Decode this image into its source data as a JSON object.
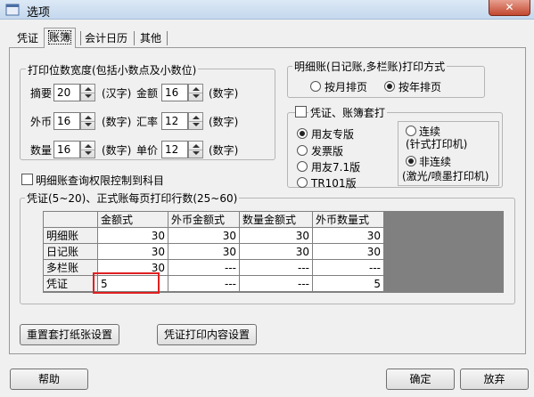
{
  "window": {
    "title": "选项",
    "close_label": "✕"
  },
  "tabs": [
    {
      "label": "凭证"
    },
    {
      "label": "账簿",
      "active": true
    },
    {
      "label": "会计日历"
    },
    {
      "label": "其他"
    }
  ],
  "print_width": {
    "title": "打印位数宽度(包括小数点及小数位)",
    "rows": [
      {
        "left_label": "摘要",
        "left_value": "20",
        "left_unit": "(汉字)",
        "right_label": "金额",
        "right_value": "16",
        "right_unit": "(数字)"
      },
      {
        "left_label": "外币",
        "left_value": "16",
        "left_unit": "(数字)",
        "right_label": "汇率",
        "right_value": "12",
        "right_unit": "(数字)"
      },
      {
        "left_label": "数量",
        "left_value": "16",
        "left_unit": "(数字)",
        "right_label": "单价",
        "right_value": "12",
        "right_unit": "(数字)"
      }
    ]
  },
  "detail_print_mode": {
    "title": "明细账(日记账,多栏账)打印方式",
    "options": [
      {
        "label": "按月排页",
        "selected": false
      },
      {
        "label": "按年排页",
        "selected": true
      }
    ]
  },
  "voucher_ledger_set_print": {
    "checkbox_label": "凭证、账簿套打",
    "checked": false,
    "versions": [
      {
        "label": "用友专版",
        "selected": true
      },
      {
        "label": "发票版",
        "selected": false
      },
      {
        "label": "用友7.1版",
        "selected": false
      },
      {
        "label": "TR101版",
        "selected": false
      }
    ],
    "continuous": {
      "label": "连续",
      "sublabel": "(针式打印机)",
      "selected": false
    },
    "non_continuous": {
      "label": "非连续",
      "sublabel": "(激光/喷墨打印机)",
      "selected": true
    }
  },
  "permission_check": {
    "label": "明细账查询权限控制到科目",
    "checked": false
  },
  "rows_per_page": {
    "title": "凭证(5~20)、正式账每页打印行数(25~60)",
    "columns": [
      "",
      "金额式",
      "外币金额式",
      "数量金额式",
      "外币数量式"
    ],
    "rows": [
      {
        "name": "明细账",
        "values": [
          "30",
          "30",
          "30",
          "30"
        ]
      },
      {
        "name": "日记账",
        "values": [
          "30",
          "30",
          "30",
          "30"
        ]
      },
      {
        "name": "多栏账",
        "values": [
          "30",
          "---",
          "---",
          "---"
        ]
      },
      {
        "name": "凭证",
        "values": [
          "5",
          "---",
          "---",
          "5"
        ]
      }
    ]
  },
  "buttons": {
    "reset_paper": "重置套打纸张设置",
    "voucher_print_content": "凭证打印内容设置",
    "help": "帮助",
    "ok": "确定",
    "cancel": "放弃"
  },
  "colors": {
    "highlight_border": "#e02020",
    "grid_background": "#808080"
  }
}
